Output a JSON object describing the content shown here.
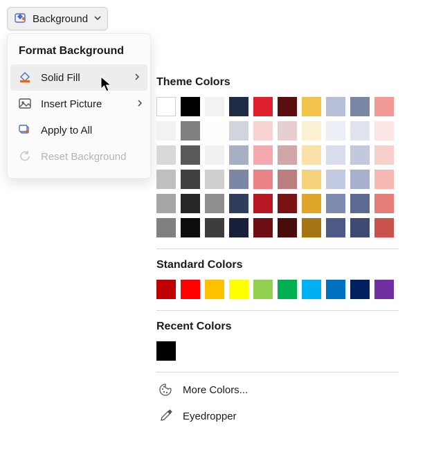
{
  "toolbar": {
    "background_label": "Background"
  },
  "menu": {
    "title": "Format Background",
    "items": [
      {
        "label": "Solid Fill",
        "has_submenu": true,
        "hovered": true
      },
      {
        "label": "Insert Picture",
        "has_submenu": true
      },
      {
        "label": "Apply to All"
      },
      {
        "label": "Reset Background",
        "disabled": true
      }
    ]
  },
  "flyout": {
    "theme_title": "Theme Colors",
    "theme_colors": [
      "#ffffff",
      "#000000",
      "#f2f2f2",
      "#1f2a44",
      "#e01f2d",
      "#5a0f0f",
      "#f3c34b",
      "#b7bfd6",
      "#7a86a3",
      "#f19a97",
      "#f2f2f2",
      "#808080",
      "#fdfdfd",
      "#d0d4df",
      "#f9d2d4",
      "#e8cfcf",
      "#fcf0d3",
      "#ebeef5",
      "#dfe3ed",
      "#fce6e5",
      "#d9d9d9",
      "#595959",
      "#f0f0f0",
      "#a7afc3",
      "#f3a9ad",
      "#d2a6a6",
      "#f9e1a7",
      "#d7ddec",
      "#c3c9dc",
      "#f9cfcc",
      "#bfbfbf",
      "#404040",
      "#cfcfcf",
      "#7c87a6",
      "#ec8288",
      "#bb7d7d",
      "#f5d27a",
      "#c2cbe2",
      "#a7b0cc",
      "#f5b8b3",
      "#a6a6a6",
      "#262626",
      "#8f8f8f",
      "#303d5c",
      "#b51823",
      "#7a1414",
      "#e0a52b",
      "#7e8bb0",
      "#5c6a92",
      "#e57c77",
      "#808080",
      "#0d0d0d",
      "#3d3d3d",
      "#16203b",
      "#6f0e14",
      "#4a0b0b",
      "#a37514",
      "#4d5a86",
      "#3e4a72",
      "#c9524c"
    ],
    "standard_title": "Standard Colors",
    "standard_colors": [
      "#c00000",
      "#ff0000",
      "#ffc000",
      "#ffff00",
      "#92d050",
      "#00b050",
      "#00b0f0",
      "#0070c0",
      "#002060",
      "#7030a0"
    ],
    "recent_title": "Recent Colors",
    "recent_colors": [
      "#000000"
    ],
    "more_colors_label": "More Colors...",
    "eyedropper_label": "Eyedropper"
  }
}
